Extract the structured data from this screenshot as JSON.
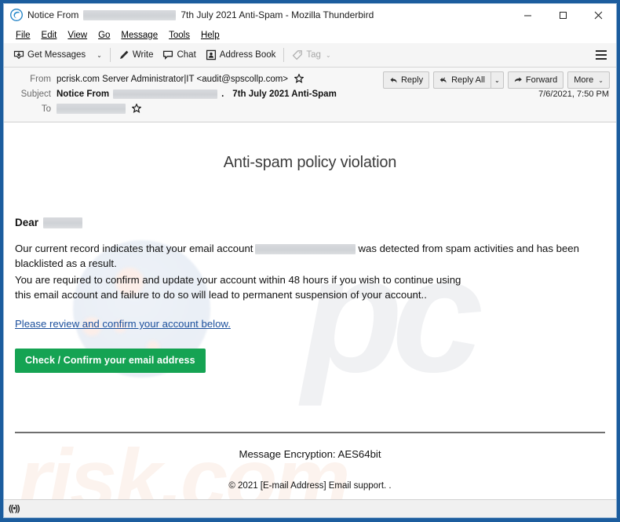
{
  "window": {
    "title_prefix": "Notice From",
    "title_suffix": "7th July 2021 Anti-Spam - Mozilla Thunderbird",
    "app_icon": "thunderbird-icon",
    "minimize_label": "–",
    "maximize_label": "☐",
    "close_label": "✕"
  },
  "menubar": {
    "items": [
      {
        "label": "File"
      },
      {
        "label": "Edit"
      },
      {
        "label": "View"
      },
      {
        "label": "Go"
      },
      {
        "label": "Message"
      },
      {
        "label": "Tools"
      },
      {
        "label": "Help"
      }
    ]
  },
  "toolbar": {
    "get_messages": "Get Messages",
    "write": "Write",
    "chat": "Chat",
    "address_book": "Address Book",
    "tag": "Tag",
    "caret": "⌄"
  },
  "message_header": {
    "from_label": "From",
    "from_value": "pcrisk.com Server Administrator|IT <audit@spscollp.com>",
    "subject_label": "Subject",
    "subject_prefix": "Notice From",
    "subject_mid": ".",
    "subject_suffix": "7th July 2021 Anti-Spam",
    "to_label": "To",
    "star_glyph": "☆",
    "date": "7/6/2021, 7:50 PM",
    "actions": {
      "reply": "Reply",
      "reply_all": "Reply All",
      "forward": "Forward",
      "more": "More",
      "reply_icon": "↶",
      "reply_all_icon": "↶",
      "forward_icon": "→",
      "caret": "⌄"
    }
  },
  "email": {
    "title": "Anti-spam policy violation",
    "greeting": "Dear",
    "para1_before": "Our current record indicates that your email account",
    "para1_after": "was detected from spam activities and has been blacklisted as a result.",
    "para2_line1": "You are required to confirm and update your account within 48 hours if you wish to continue using",
    "para2_line2": "this email account and failure to do so will lead to permanent suspension of your account..",
    "link_text": "Please review and confirm your account below.",
    "cta_label": "Check / Confirm your email address",
    "footer_encryption": "Message Encryption: AES64bit",
    "footer_copyright": "© 2021 [E-mail Address] Email support. .",
    "watermark_pc": "pc",
    "watermark_risk": "risk.com"
  },
  "statusbar": {
    "icon_glyph": "((•))"
  },
  "colors": {
    "window_frame": "#1c5d9e",
    "cta_green": "#15a353",
    "link_blue": "#1b4f9c",
    "toolbar_bg": "#f5f5f5",
    "header_bg": "#f7f7f7"
  }
}
